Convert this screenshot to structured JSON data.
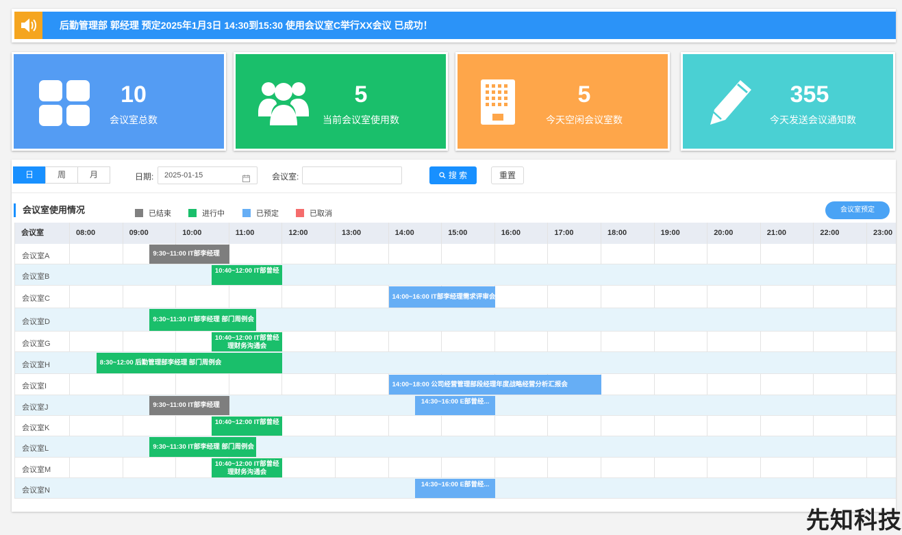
{
  "notice": {
    "text": "后勤管理部 郭经理 预定2025年1月3日 14:30到15:30 使用会议室C举行XX会议 已成功！",
    "icon": "speaker-icon"
  },
  "cards": [
    {
      "value": "10",
      "label": "会议室总数",
      "color": "#549cf3",
      "icon": "grid-icon"
    },
    {
      "value": "5",
      "label": "当前会议室使用数",
      "color": "#1abf6b",
      "icon": "users-icon"
    },
    {
      "value": "5",
      "label": "今天空闲会议室数",
      "color": "#fea64a",
      "icon": "building-icon"
    },
    {
      "value": "355",
      "label": "今天发送会议通知数",
      "color": "#4ad0d3",
      "icon": "pencil-icon"
    }
  ],
  "filters": {
    "view_tabs": [
      "日",
      "周",
      "月"
    ],
    "active_tab": "日",
    "date_label": "日期:",
    "date_value": "2025-01-15",
    "room_label": "会议室:",
    "room_value": "",
    "search_label": "搜 索",
    "reset_label": "重置"
  },
  "section": {
    "title": "会议室使用情况",
    "book_button": "会议室预定",
    "legend": [
      {
        "label": "已结束",
        "color": "#808080"
      },
      {
        "label": "进行中",
        "color": "#1abf6b"
      },
      {
        "label": "已预定",
        "color": "#66aef5"
      },
      {
        "label": "已取消",
        "color": "#f56c6c"
      }
    ]
  },
  "schedule": {
    "header_label": "会议室",
    "hours": [
      "08:00",
      "09:00",
      "10:00",
      "11:00",
      "12:00",
      "13:00",
      "14:00",
      "15:00",
      "16:00",
      "17:00",
      "18:00",
      "19:00",
      "20:00",
      "21:00",
      "22:00",
      "23:00"
    ],
    "rooms": [
      {
        "name": "会议室A",
        "events": [
          {
            "start": 9.5,
            "end": 11.0,
            "text": "9:30~11:00  IT部李经理",
            "status": "ended"
          }
        ]
      },
      {
        "name": "会议室B",
        "events": [
          {
            "start": 10.67,
            "end": 12.0,
            "text": "10:40~12:00  IT部曾经",
            "status": "ongoing"
          }
        ]
      },
      {
        "name": "会议室C",
        "events": [
          {
            "start": 14.0,
            "end": 16.0,
            "text": "14:00~16:00  IT部李经理需求评审会",
            "status": "booked"
          }
        ]
      },
      {
        "name": "会议室D",
        "events": [
          {
            "start": 9.5,
            "end": 11.5,
            "text": "9:30~11:30  IT部李经理 部门周例会",
            "status": "ongoing"
          }
        ]
      },
      {
        "name": "会议室G",
        "events": [
          {
            "start": 10.67,
            "end": 12.0,
            "text": "10:40~12:00  IT部曾经理财务沟通会",
            "status": "ongoing"
          }
        ]
      },
      {
        "name": "会议室H",
        "events": [
          {
            "start": 8.5,
            "end": 12.0,
            "text": "8:30~12:00  后勤管理部李经理 部门周例会",
            "status": "ongoing"
          }
        ]
      },
      {
        "name": "会议室I",
        "events": [
          {
            "start": 14.0,
            "end": 18.0,
            "text": "14:00~18:00  公司经营管理部段经理年度战略经营分析汇报会",
            "status": "booked"
          }
        ]
      },
      {
        "name": "会议室J",
        "events": [
          {
            "start": 9.5,
            "end": 11.0,
            "text": "9:30~11:00  IT部李经理",
            "status": "ended"
          },
          {
            "start": 14.5,
            "end": 16.0,
            "text": "14:30~16:00  E部曾经...",
            "status": "booked"
          }
        ]
      },
      {
        "name": "会议室K",
        "events": [
          {
            "start": 10.67,
            "end": 12.0,
            "text": "10:40~12:00  IT部曾经",
            "status": "ongoing"
          }
        ]
      },
      {
        "name": "会议室L",
        "events": [
          {
            "start": 9.5,
            "end": 11.5,
            "text": "9:30~11:30  IT部李经理 部门周例会",
            "status": "ongoing"
          }
        ]
      },
      {
        "name": "会议室M",
        "events": [
          {
            "start": 10.67,
            "end": 12.0,
            "text": "10:40~12:00  IT部曾经理财务沟通会",
            "status": "ongoing"
          }
        ]
      },
      {
        "name": "会议室N",
        "events": [
          {
            "start": 14.5,
            "end": 16.0,
            "text": "14:30~16:00  E部曾经...",
            "status": "booked"
          }
        ]
      }
    ]
  },
  "watermark": "先知科技"
}
